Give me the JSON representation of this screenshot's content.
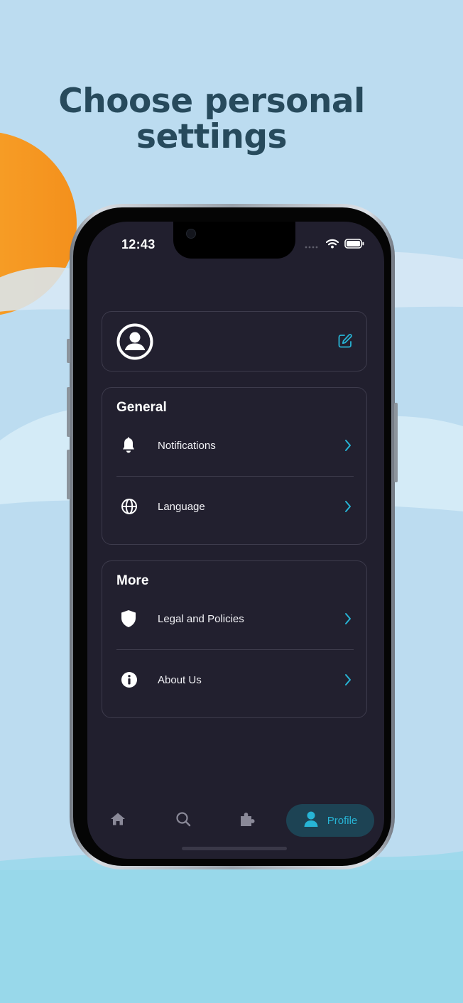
{
  "headline": {
    "line1": "Choose personal",
    "line2": "settings"
  },
  "status_bar": {
    "time": "12:43"
  },
  "profile": {
    "avatar_icon": "user-circle-icon",
    "edit_icon": "edit-icon"
  },
  "general": {
    "title": "General",
    "items": [
      {
        "label": "Notifications",
        "icon": "bell-icon"
      },
      {
        "label": "Language",
        "icon": "globe-icon"
      }
    ]
  },
  "more": {
    "title": "More",
    "items": [
      {
        "label": "Legal and Policies",
        "icon": "shield-icon"
      },
      {
        "label": "About Us",
        "icon": "info-icon"
      }
    ]
  },
  "tabbar": {
    "tabs": [
      {
        "icon": "home-icon"
      },
      {
        "icon": "search-icon"
      },
      {
        "icon": "puzzle-icon"
      },
      {
        "icon": "user-icon",
        "label": "Profile",
        "active": true
      }
    ]
  },
  "colors": {
    "accent": "#27b4d5",
    "screen_bg": "#211f2e",
    "card_border": "#3d3b4c",
    "headline": "#274a5c",
    "sky": "#bcdcf0",
    "sun": "#f7a12b",
    "water": "#98d8ea"
  }
}
